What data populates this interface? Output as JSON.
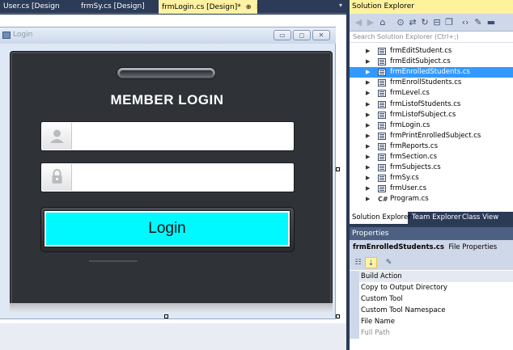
{
  "doc_tabs": [
    {
      "label": "User.cs [Design]*",
      "active": false
    },
    {
      "label": "frmSy.cs [Design]",
      "active": false
    },
    {
      "label": "frmLogin.cs [Design]*",
      "active": true
    }
  ],
  "form": {
    "title": "Login",
    "heading": "MEMBER LOGIN",
    "username_value": "",
    "password_value": "",
    "login_label": "Login",
    "minimize_glyph": "▭",
    "maximize_glyph": "◻",
    "close_glyph": "✕"
  },
  "solution_explorer": {
    "title": "Solution Explorer",
    "search_placeholder": "Search Solution Explorer (Ctrl+;)",
    "files": [
      {
        "label": "frmEditStudent.cs",
        "kind": "form",
        "selected": false
      },
      {
        "label": "frmEditSubject.cs",
        "kind": "form",
        "selected": false
      },
      {
        "label": "frmEnrolledStudents.cs",
        "kind": "form",
        "selected": true
      },
      {
        "label": "frmEnrollStudents.cs",
        "kind": "form",
        "selected": false
      },
      {
        "label": "frmLevel.cs",
        "kind": "form",
        "selected": false
      },
      {
        "label": "frmListofStudents.cs",
        "kind": "form",
        "selected": false
      },
      {
        "label": "frmListofSubject.cs",
        "kind": "form",
        "selected": false
      },
      {
        "label": "frmLogin.cs",
        "kind": "form",
        "selected": false
      },
      {
        "label": "frmPrintEnrolledSubject.cs",
        "kind": "form",
        "selected": false
      },
      {
        "label": "frmReports.cs",
        "kind": "form",
        "selected": false
      },
      {
        "label": "frmSection.cs",
        "kind": "form",
        "selected": false
      },
      {
        "label": "frmSubjects.cs",
        "kind": "form",
        "selected": false
      },
      {
        "label": "frmSy.cs",
        "kind": "form",
        "selected": false
      },
      {
        "label": "frmUser.cs",
        "kind": "form",
        "selected": false
      },
      {
        "label": "Program.cs",
        "kind": "code",
        "selected": false
      }
    ],
    "tabs": [
      "Solution Explorer",
      "Team Explorer",
      "Class View"
    ]
  },
  "properties": {
    "title": "Properties",
    "object_name": "frmEnrolledStudents.cs",
    "object_type": "File Properties",
    "rows": [
      {
        "name": "Build Action",
        "selected": true,
        "dim": false
      },
      {
        "name": "Copy to Output Directory",
        "selected": false,
        "dim": false
      },
      {
        "name": "Custom Tool",
        "selected": false,
        "dim": false
      },
      {
        "name": "Custom Tool Namespace",
        "selected": false,
        "dim": false
      },
      {
        "name": "File Name",
        "selected": false,
        "dim": false
      },
      {
        "name": "Full Path",
        "selected": false,
        "dim": true
      }
    ]
  },
  "colors": {
    "accent_cyan": "#00f8ff",
    "selection_blue": "#3399ff",
    "active_tab_yellow": "#fff2a3"
  }
}
